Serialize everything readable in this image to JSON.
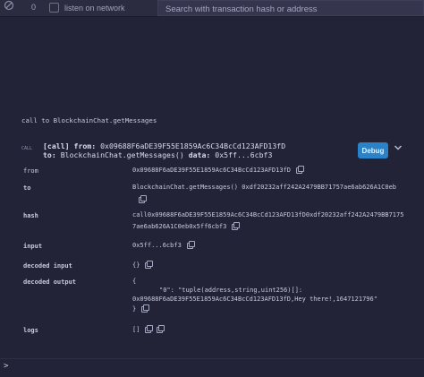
{
  "toolbar": {
    "clear_icon": "clear-console-icon",
    "count": "0",
    "listen_label": "listen on network",
    "search_placeholder": "Search with transaction hash or address"
  },
  "terminal": {
    "message": "call to BlockchainChat.getMessages",
    "call_tag": "CALL",
    "call": {
      "prefix": "[call]",
      "from_label": "from:",
      "from_value": "0x09688F6aDE39F55E1859Ac6C34BcCd123AFD13fD",
      "to_label": "to:",
      "to_value": "BlockchainChat.getMessages()",
      "data_label": "data:",
      "data_value": "0x5ff...6cbf3"
    },
    "debug_label": "Debug"
  },
  "details": {
    "from": {
      "label": "from",
      "value": "0x09688F6aDE39F55E1859Ac6C34BcCd123AFD13fD"
    },
    "to": {
      "label": "to",
      "value": "BlockchainChat.getMessages() 0xdf20232aff242A2479BB71757ae6ab626A1C0eb"
    },
    "hash": {
      "label": "hash",
      "line1": "call0x09688F6aDE39F55E1859Ac6C34BcCd123AFD13fD0xdf20232aff242A2479BB7175",
      "line2": "7ae6ab626A1C0eb0x5ff6cbf3"
    },
    "input": {
      "label": "input",
      "value": "0x5ff...6cbf3"
    },
    "decoded_input": {
      "label": "decoded input",
      "value": "{}"
    },
    "decoded_output": {
      "label": "decoded output",
      "open": "{",
      "line1": "\"0\": \"tuple(address,string,uint256)[]:",
      "line2": "0x09688F6aDE39F55E1859Ac6C34BcCd123AFD13fD,Hey there!,1647121796\"",
      "close": "}"
    },
    "logs": {
      "label": "logs",
      "value": "[]"
    }
  },
  "prompt": ">"
}
